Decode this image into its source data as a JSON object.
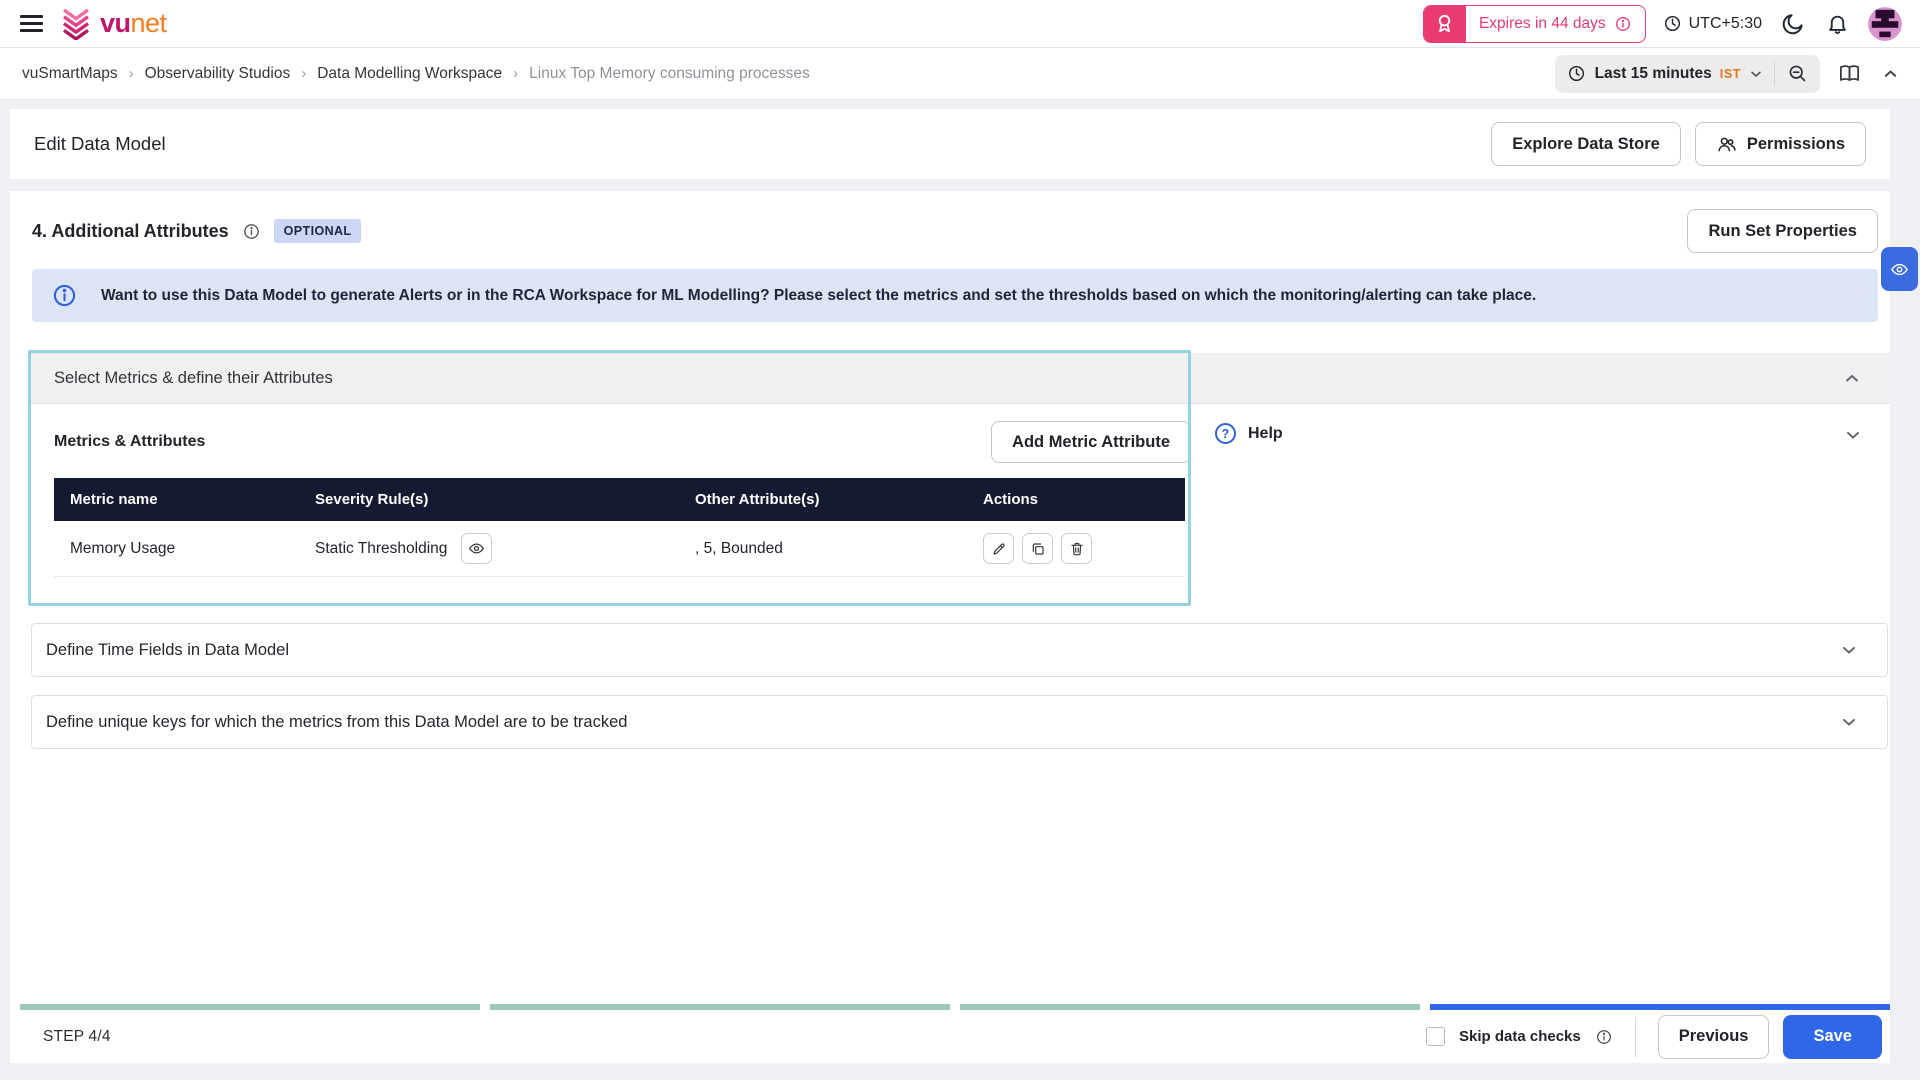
{
  "header": {
    "logo_vu": "vu",
    "logo_net": "net",
    "license_badge": "Expires in 44 days",
    "timezone": "UTC+5:30"
  },
  "breadcrumb": {
    "items": [
      "vuSmartMaps",
      "Observability Studios",
      "Data Modelling Workspace",
      "Linux Top Memory consuming processes"
    ]
  },
  "timebar": {
    "range_label": "Last 15 minutes",
    "timezone_short": "IST"
  },
  "page": {
    "title": "Edit Data Model",
    "explore_button": "Explore Data Store",
    "permissions_button": "Permissions"
  },
  "step_section": {
    "heading": "4. Additional Attributes",
    "optional_badge": "OPTIONAL",
    "run_set_properties_button": "Run Set Properties",
    "banner_text": "Want to use this Data Model to generate Alerts or in the RCA Workspace for ML Modelling? Please select the metrics and set the thresholds based on which the monitoring/alerting can take place."
  },
  "metrics_section": {
    "header": "Select Metrics & define their Attributes",
    "subheading": "Metrics & Attributes",
    "add_button": "Add Metric Attribute",
    "help_label": "Help",
    "table": {
      "columns": [
        "Metric name",
        "Severity Rule(s)",
        "Other Attribute(s)",
        "Actions"
      ],
      "rows": [
        {
          "metric_name": "Memory Usage",
          "severity_rule": "Static Thresholding",
          "other_attributes": ", 5, Bounded"
        }
      ]
    }
  },
  "collapsed_sections": {
    "time_fields": "Define Time Fields in Data Model",
    "unique_keys": "Define unique keys for which the metrics from this Data Model are to be tracked"
  },
  "footer": {
    "step_label": "STEP 4/4",
    "skip_checkbox_label": "Skip data checks",
    "previous_button": "Previous",
    "save_button": "Save"
  },
  "colors": {
    "brand_pink": "#e93a72",
    "brand_magenta": "#c4156b",
    "brand_orange": "#f57d1f",
    "accent_blue": "#2e68e8",
    "link_blue": "#2b63d9",
    "table_header_navy": "#141a30",
    "highlight_teal": "#93d2e0",
    "progress_teal": "#9cc8b6",
    "banner_blue_bg": "#dde4f6",
    "ist_orange": "#e8731a"
  }
}
